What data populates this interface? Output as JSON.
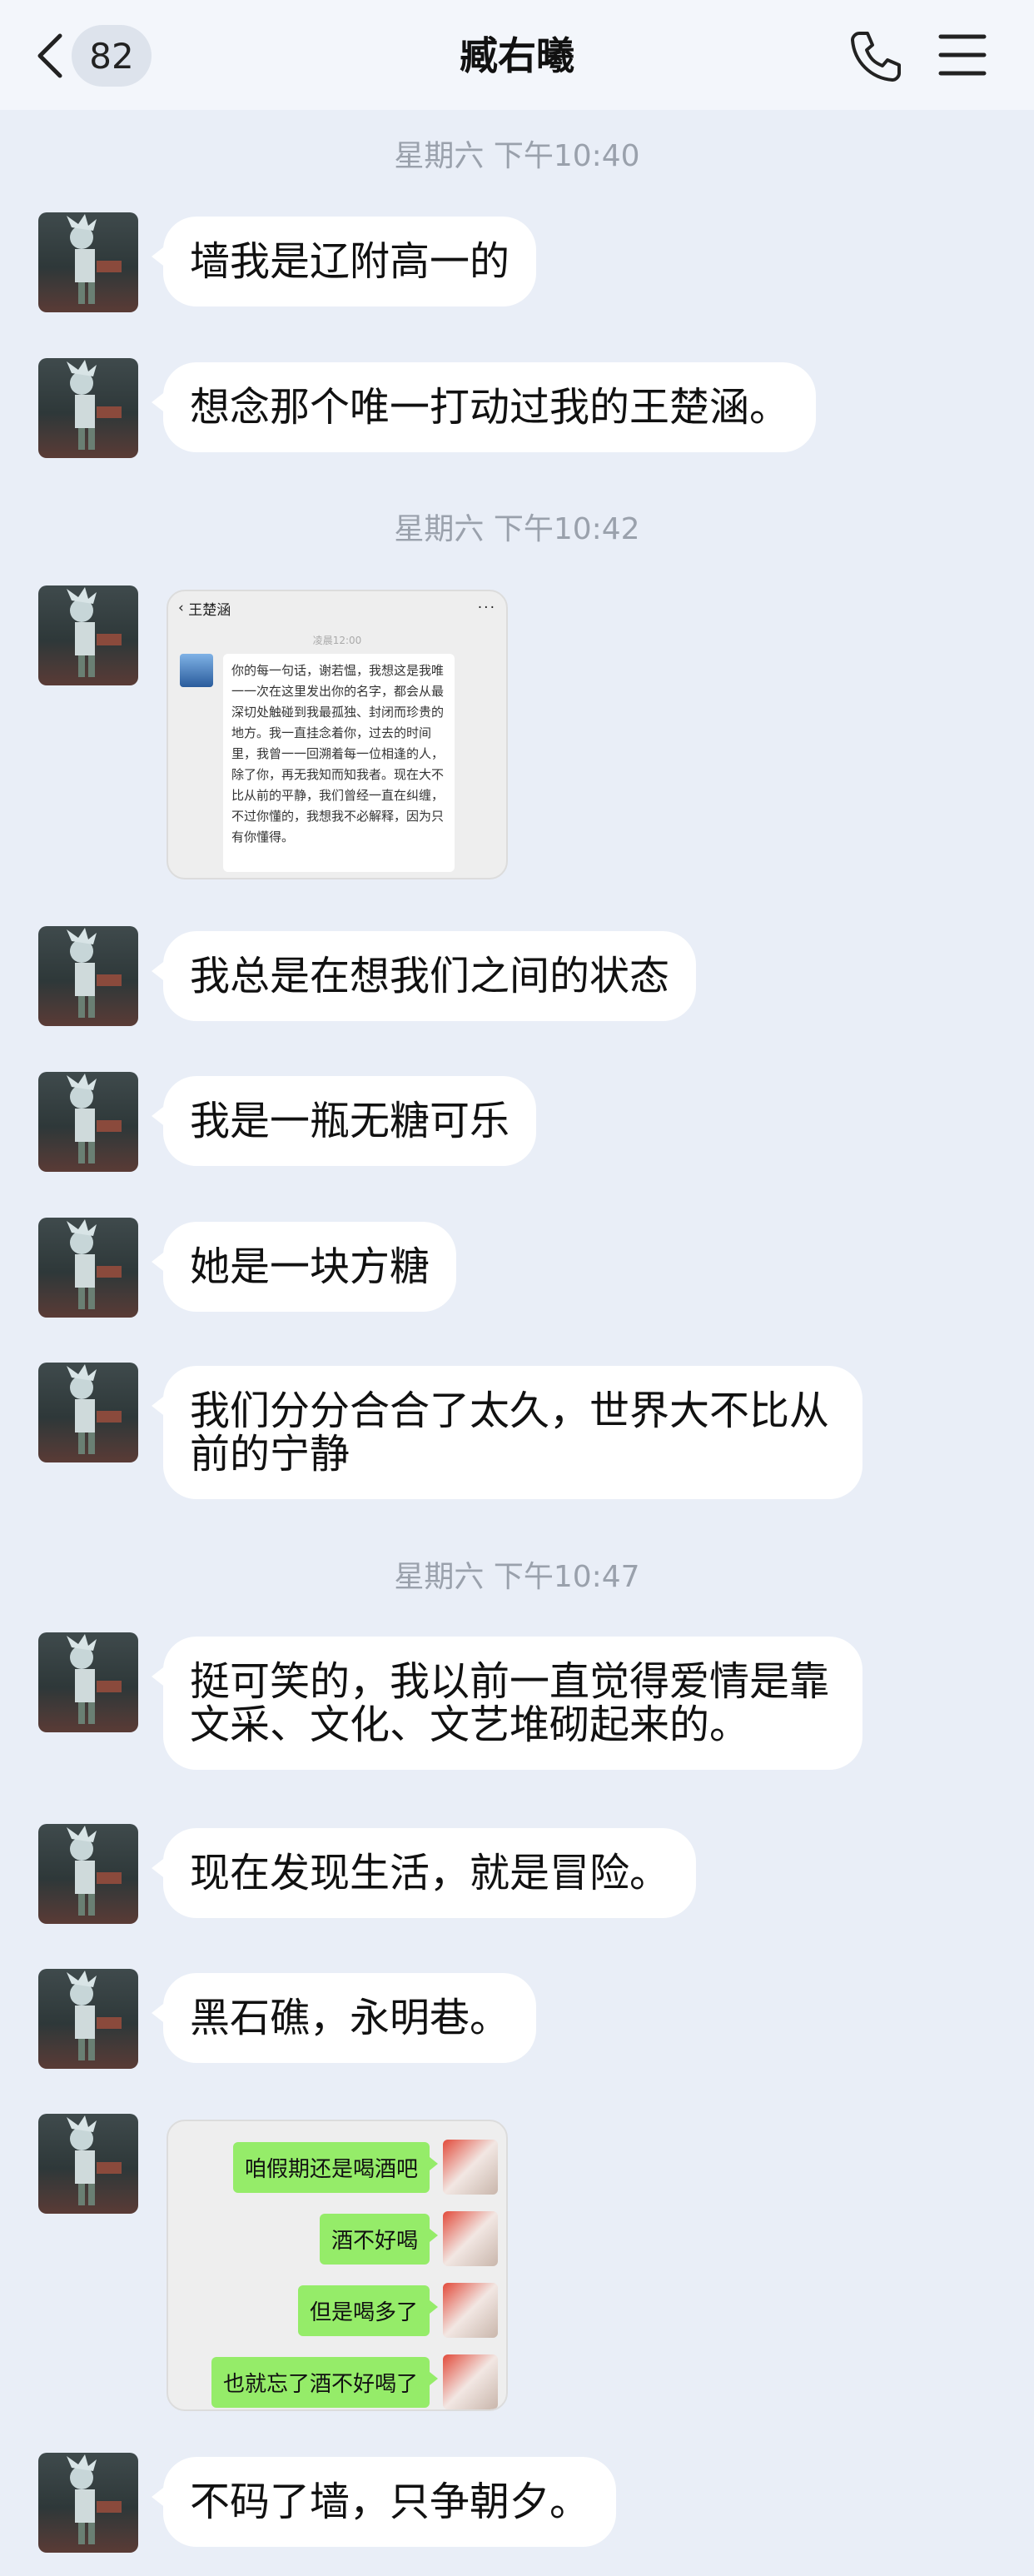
{
  "header": {
    "unread_count": "82",
    "title": "臧右曦"
  },
  "timestamps": [
    "星期六 下午10:40",
    "星期六 下午10:42",
    "星期六 下午10:47"
  ],
  "messages": [
    "墙我是辽附高一的",
    "想念那个唯一打动过我的王楚涵。",
    "我总是在想我们之间的状态",
    "我是一瓶无糖可乐",
    "她是一块方糖",
    "我们分分合合了太久，世界大不比从前的宁静",
    "挺可笑的，我以前一直觉得爱情是靠文采、文化、文艺堆砌起来的。",
    "现在发现生活，就是冒险。",
    "黑石礁，永明巷。",
    "不码了墙，只争朝夕。"
  ],
  "screenshot1": {
    "name": "王楚涵",
    "more": "···",
    "time": "凌晨12:00",
    "text": "你的每一句话，谢若愠，我想这是我唯一一次在这里发出你的名字，都会从最深切处触碰到我最孤独、封闭而珍贵的地方。我一直挂念着你，过去的时间里，我曾一一回溯着每一位相逢的人，除了你，再无我知而知我者。现在大不比从前的平静，我们曾经一直在纠缠，不过你懂的，我想我不必解释，因为只有你懂得。"
  },
  "screenshot2": {
    "messages": [
      "咱假期还是喝酒吧",
      "酒不好喝",
      "但是喝多了",
      "也就忘了酒不好喝了"
    ]
  }
}
